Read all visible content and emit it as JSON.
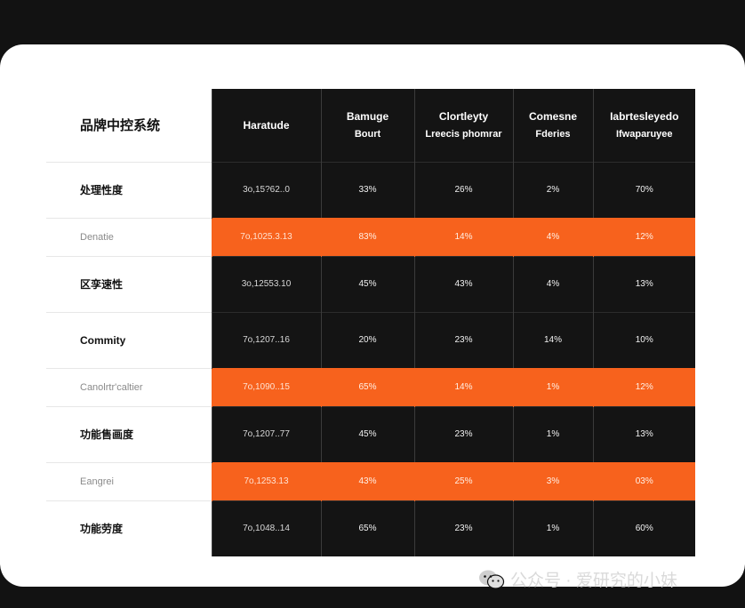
{
  "table": {
    "corner": "品牌中控系统",
    "headers": [
      {
        "line1": "Haratude",
        "line2": ""
      },
      {
        "line1": "Bamuge",
        "line2": "Bourt"
      },
      {
        "line1": "Clortleyty",
        "line2": "Lreecis phomrar"
      },
      {
        "line1": "Comesne",
        "line2": "Fderies"
      },
      {
        "line1": "Iabrtesleyedo",
        "line2": "Ifwaparuyee"
      }
    ],
    "rows": [
      {
        "label": "处理性度",
        "style": "dark",
        "values": [
          "3o,15?62..0",
          "33%",
          "26%",
          "2%",
          "70%"
        ]
      },
      {
        "label": "Denatie",
        "style": "orange",
        "values": [
          "7o,1025.3.13",
          "83%",
          "14%",
          "4%",
          "12%"
        ]
      },
      {
        "label": "区孪速性",
        "style": "dark",
        "values": [
          "3o,12553.10",
          "45%",
          "43%",
          "4%",
          "13%"
        ]
      },
      {
        "label": "Commity",
        "style": "dark",
        "values": [
          "7o,1207..16",
          "20%",
          "23%",
          "14%",
          "10%"
        ]
      },
      {
        "label": "Canolrtr'caltier",
        "style": "orange",
        "values": [
          "7o,1090..15",
          "65%",
          "14%",
          "1%",
          "12%"
        ]
      },
      {
        "label": "功能售画度",
        "style": "dark",
        "values": [
          "7o,1207..77",
          "45%",
          "23%",
          "1%",
          "13%"
        ]
      },
      {
        "label": "Eangrei",
        "style": "orange",
        "values": [
          "7o,1253.13",
          "43%",
          "25%",
          "3%",
          "03%"
        ]
      },
      {
        "label": "功能劳度",
        "style": "dark",
        "values": [
          "7o,1048..14",
          "65%",
          "23%",
          "1%",
          "60%"
        ]
      }
    ]
  },
  "watermark": {
    "text": "公众号 · 爱研究的小妹",
    "icon": "wechat-icon"
  },
  "colors": {
    "dark": "#141414",
    "accent": "#f7621d",
    "background": "#121212",
    "card": "#ffffff"
  }
}
